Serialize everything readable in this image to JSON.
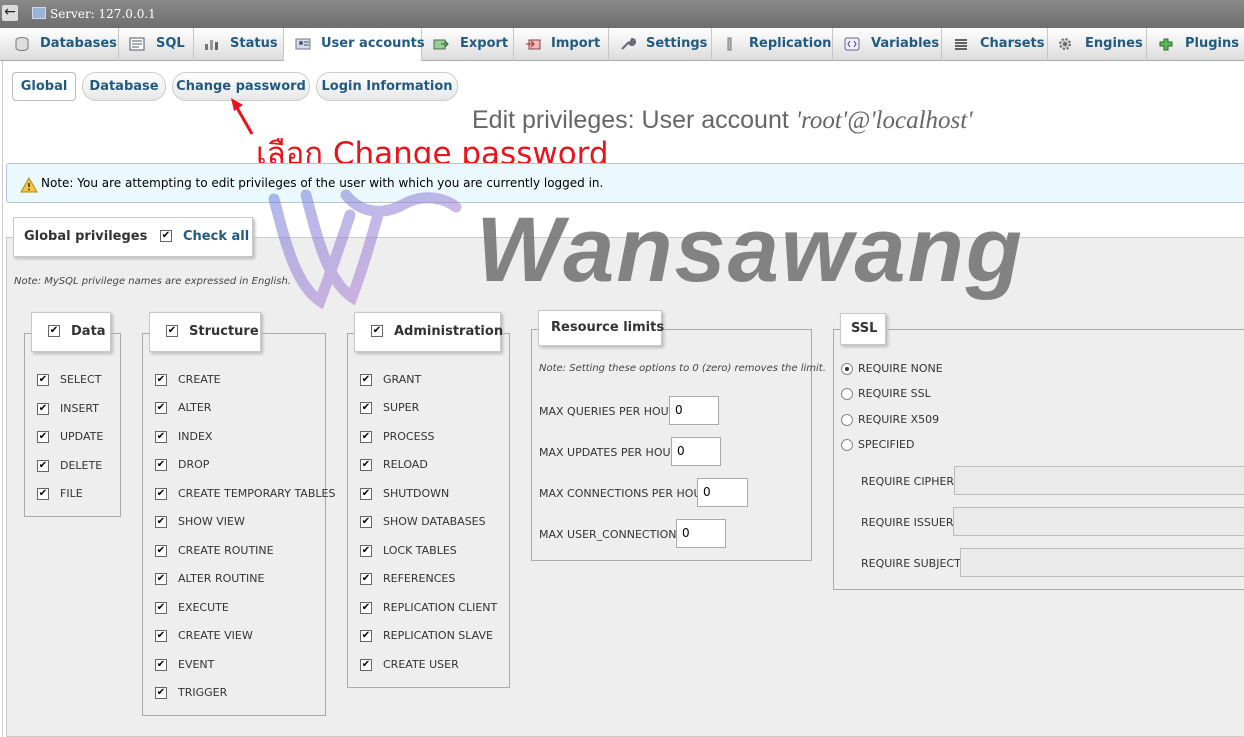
{
  "server": {
    "back_glyph": "←",
    "title": "Server: 127.0.0.1"
  },
  "tabs": [
    {
      "label": "Databases",
      "icon": "database-icon"
    },
    {
      "label": "SQL",
      "icon": "sql-icon"
    },
    {
      "label": "Status",
      "icon": "status-icon"
    },
    {
      "label": "User accounts",
      "icon": "users-icon",
      "active": true
    },
    {
      "label": "Export",
      "icon": "export-icon"
    },
    {
      "label": "Import",
      "icon": "import-icon"
    },
    {
      "label": "Settings",
      "icon": "wrench-icon"
    },
    {
      "label": "Replication",
      "icon": "replication-icon"
    },
    {
      "label": "Variables",
      "icon": "variables-icon"
    },
    {
      "label": "Charsets",
      "icon": "charsets-icon"
    },
    {
      "label": "Engines",
      "icon": "engines-icon"
    },
    {
      "label": "Plugins",
      "icon": "plugins-icon"
    }
  ],
  "subtabs": [
    "Global",
    "Database",
    "Change password",
    "Login Information"
  ],
  "page_title": {
    "prefix": "Edit privileges: User account",
    "account": "'root'@'localhost'"
  },
  "annotation": "เลือก Change password",
  "notice": "Note: You are attempting to edit privileges of the user with which you are currently logged in.",
  "watermark": "Wansawang",
  "global": {
    "title": "Global privileges",
    "check_all": "Check all",
    "note": "Note: MySQL privilege names are expressed in English."
  },
  "groups": {
    "data": {
      "title": "Data",
      "items": [
        "SELECT",
        "INSERT",
        "UPDATE",
        "DELETE",
        "FILE"
      ]
    },
    "structure": {
      "title": "Structure",
      "items": [
        "CREATE",
        "ALTER",
        "INDEX",
        "DROP",
        "CREATE TEMPORARY TABLES",
        "SHOW VIEW",
        "CREATE ROUTINE",
        "ALTER ROUTINE",
        "EXECUTE",
        "CREATE VIEW",
        "EVENT",
        "TRIGGER"
      ]
    },
    "administration": {
      "title": "Administration",
      "items": [
        "GRANT",
        "SUPER",
        "PROCESS",
        "RELOAD",
        "SHUTDOWN",
        "SHOW DATABASES",
        "LOCK TABLES",
        "REFERENCES",
        "REPLICATION CLIENT",
        "REPLICATION SLAVE",
        "CREATE USER"
      ]
    }
  },
  "resource_limits": {
    "title": "Resource limits",
    "note": "Note: Setting these options to 0 (zero) removes the limit.",
    "rows": [
      {
        "label": "MAX QUERIES PER HOUR",
        "value": "0"
      },
      {
        "label": "MAX UPDATES PER HOUR",
        "value": "0"
      },
      {
        "label": "MAX CONNECTIONS PER HOUR",
        "value": "0"
      },
      {
        "label": "MAX USER_CONNECTIONS",
        "value": "0"
      }
    ]
  },
  "ssl": {
    "title": "SSL",
    "options": [
      "REQUIRE NONE",
      "REQUIRE SSL",
      "REQUIRE X509",
      "SPECIFIED"
    ],
    "selected": "REQUIRE NONE",
    "fields": [
      "REQUIRE CIPHER",
      "REQUIRE ISSUER",
      "REQUIRE SUBJECT"
    ]
  }
}
